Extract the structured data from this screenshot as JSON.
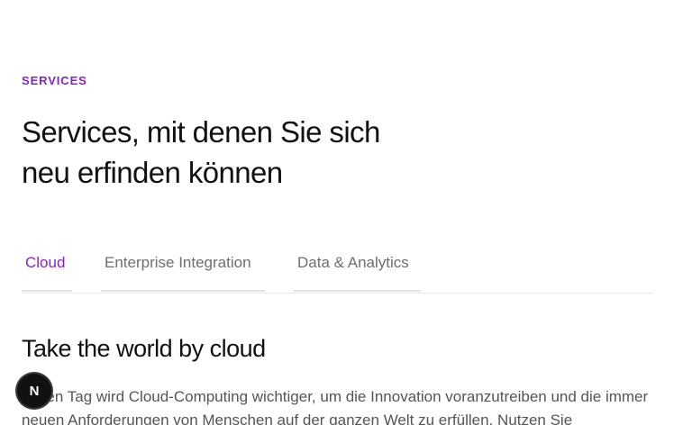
{
  "section": {
    "eyebrow": "SERVICES",
    "headline_line1": "Services, mit denen Sie sich",
    "headline_line2": "neu erfinden können"
  },
  "tabs": [
    {
      "label": "Cloud",
      "active": true
    },
    {
      "label": "Enterprise Integration",
      "active": false
    },
    {
      "label": "Data & Analytics",
      "active": false
    }
  ],
  "panel": {
    "title": "Take the world by cloud",
    "body": "Jeden Tag wird Cloud-Computing wichtiger, um die Innovation voranzutreiben und die immer neuen Anforderungen von Menschen auf der ganzen Welt zu erfüllen. Nutzen Sie"
  },
  "badge": {
    "letter": "N",
    "icon": "n-logo-icon"
  },
  "colors": {
    "accent": "#8b1fd3",
    "text": "#111111",
    "muted": "#6e6e73"
  }
}
